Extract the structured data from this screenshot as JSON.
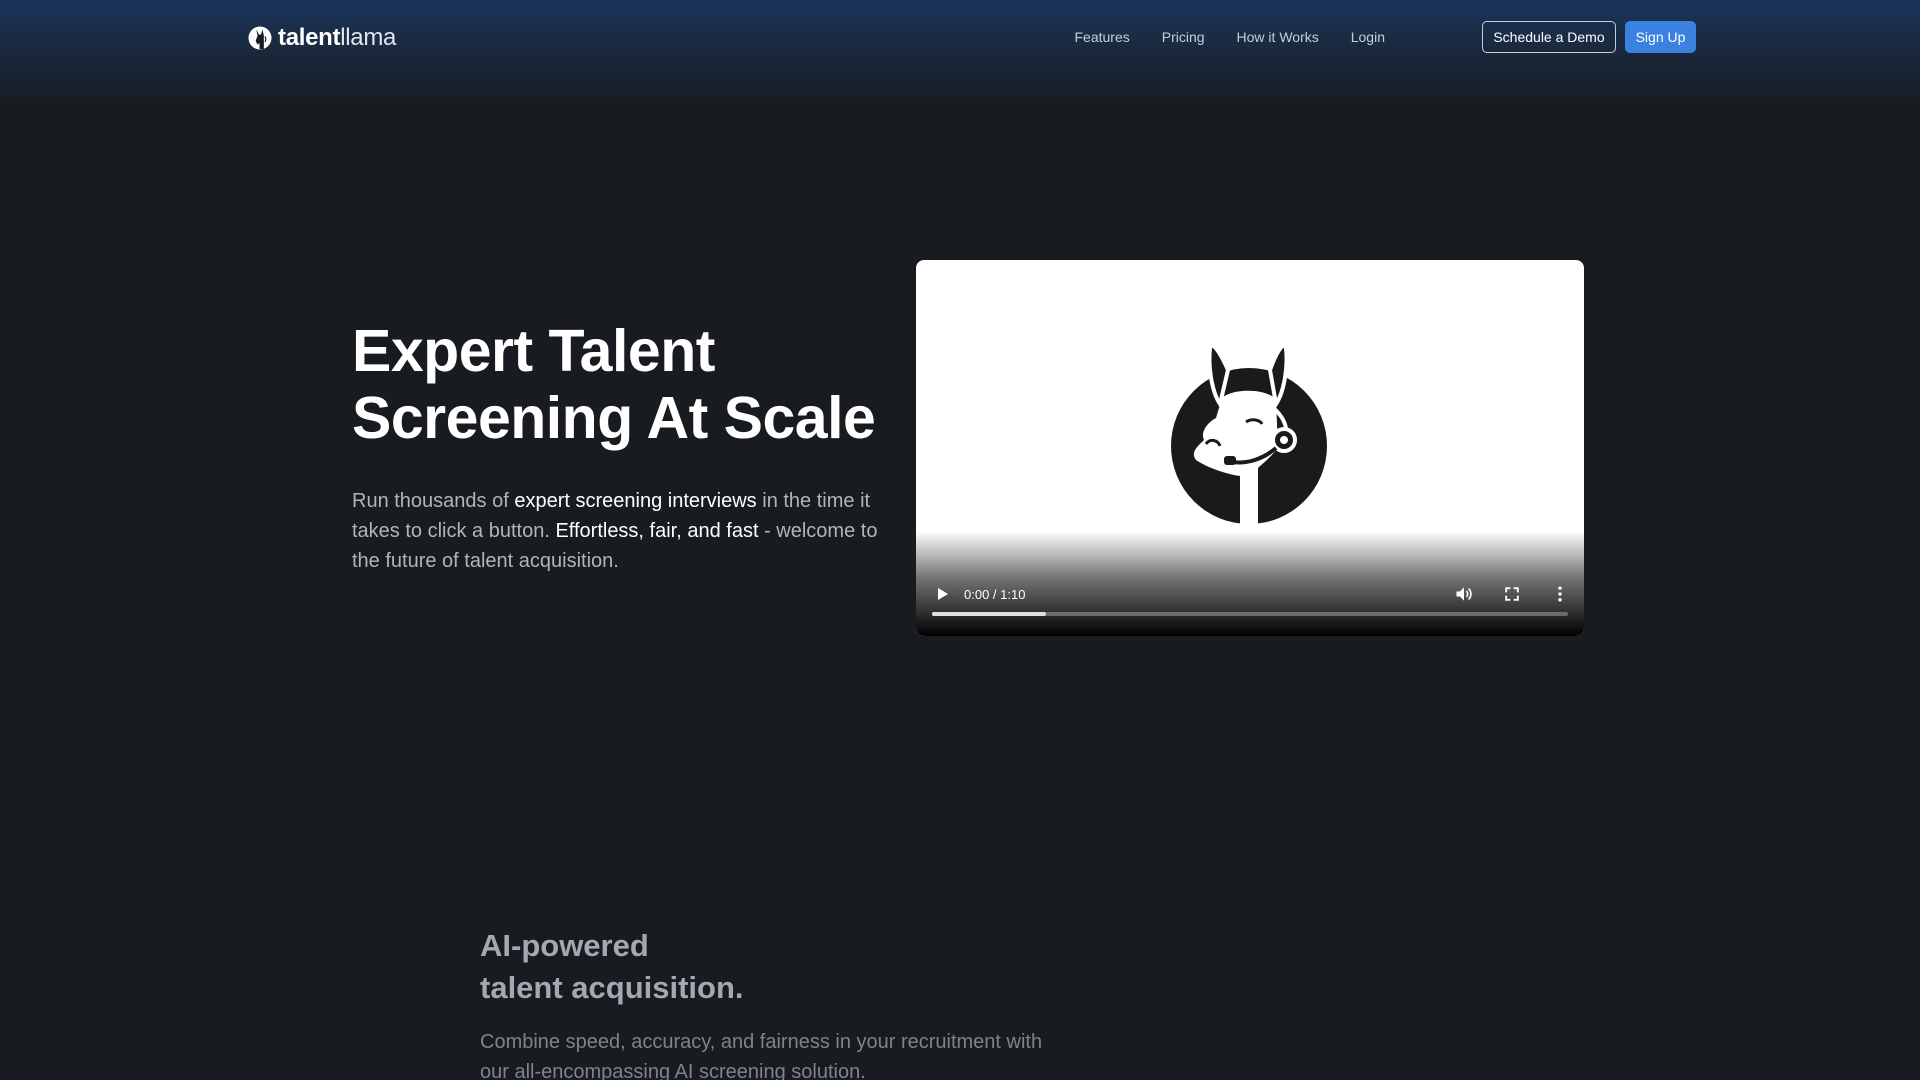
{
  "brand": {
    "name_bold": "talent",
    "name_light": "llama",
    "icon": "llama-headset-logo-icon"
  },
  "nav": {
    "links": [
      "Features",
      "Pricing",
      "How it Works",
      "Login"
    ],
    "schedule_demo_label": "Schedule a Demo",
    "signup_label": "Sign Up",
    "accent_color": "#3b82e0"
  },
  "hero": {
    "title_line1": "Expert Talent",
    "title_line2": "Screening At Scale",
    "subtitle": {
      "part1": "Run thousands of ",
      "hl1": "expert screening interviews",
      "part2": " in the time it takes to click a button. ",
      "hl2": "Effortless, fair, and fast",
      "part3": " - welcome to the future of talent acquisition."
    }
  },
  "video": {
    "current_time": "0:00",
    "separator": " / ",
    "duration": "1:10",
    "buffered_fraction": 0.18,
    "icons": [
      "play-icon",
      "volume-icon",
      "fullscreen-icon",
      "more-options-icon"
    ]
  },
  "feature": {
    "title_line1": "AI-powered",
    "title_line2": "talent acquisition.",
    "description": "Combine speed, accuracy, and fairness in your recruitment with our all-encompassing AI screening solution."
  },
  "colors": {
    "background": "#181b1f",
    "header_gradient_top": "#1a355a"
  }
}
